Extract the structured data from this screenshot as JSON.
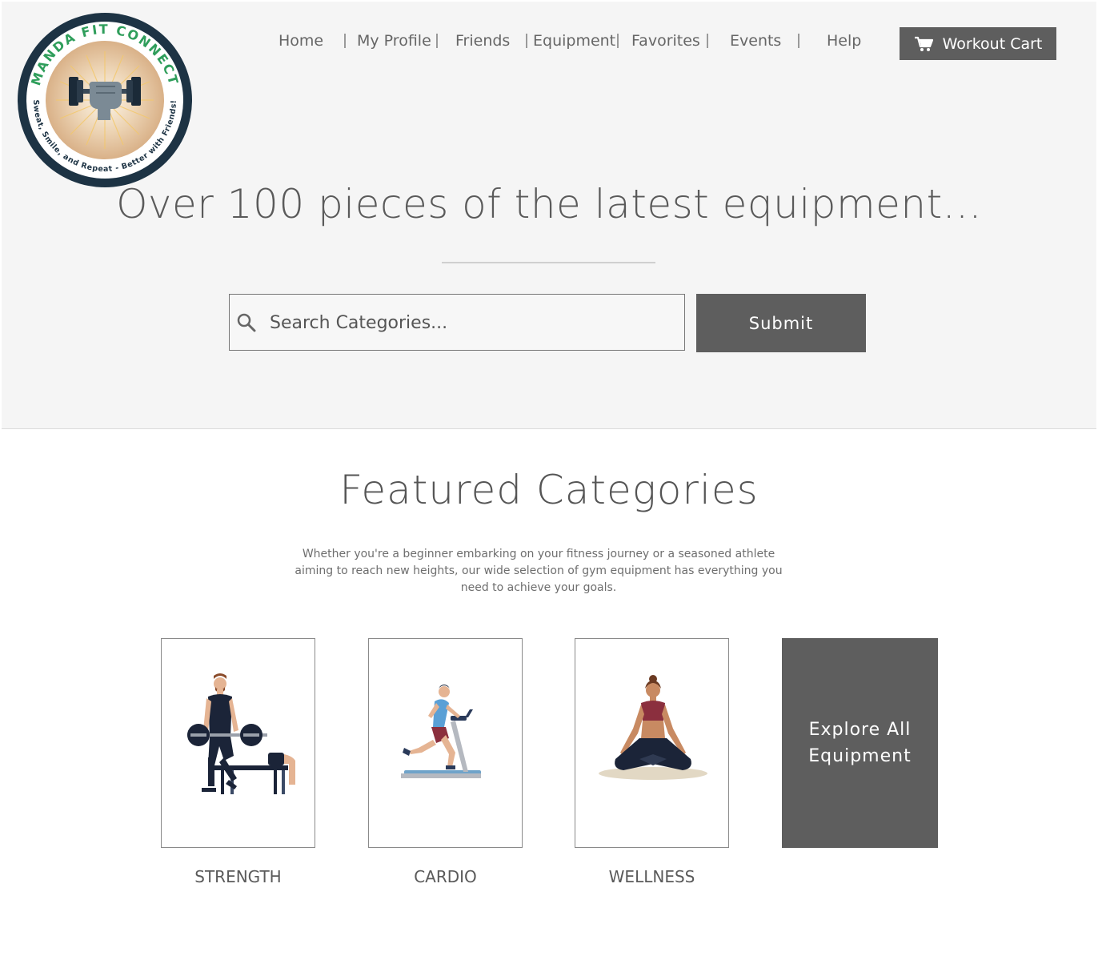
{
  "logo": {
    "top_text": "MANDA FIT CONNECT",
    "bottom_text": "Sweat, Smile, and Repeat - Better with Friends!",
    "icon": "fist-dumbbell-icon"
  },
  "nav": {
    "items": [
      "Home",
      "My Profile",
      "Friends",
      "Equipment",
      "Favorites",
      "Events",
      "Help"
    ],
    "separator_icon": "vertical-bar"
  },
  "cart": {
    "label": "Workout Cart",
    "icon": "cart-icon"
  },
  "hero": {
    "title": "Over 100 pieces of the latest equipment...",
    "search_placeholder": "Search Categories...",
    "search_icon": "search-icon",
    "submit_label": "Submit"
  },
  "featured": {
    "title": "Featured Categories",
    "description": "Whether you're a beginner embarking on your fitness journey or a seasoned athlete aiming to reach new heights, our wide selection of gym equipment has everything you need to achieve your goals.",
    "categories": [
      {
        "label": "STRENGTH",
        "icon": "barbell-lifter-icon"
      },
      {
        "label": "CARDIO",
        "icon": "treadmill-runner-icon"
      },
      {
        "label": "WELLNESS",
        "icon": "yoga-meditation-icon"
      }
    ],
    "explore_label": "Explore All Equipment"
  },
  "colors": {
    "hero_bg": "#f5f5f5",
    "button_bg": "#5e5e5e",
    "text": "#555555",
    "logo_ring": "#1d3344",
    "logo_green": "#2f9e5b"
  }
}
